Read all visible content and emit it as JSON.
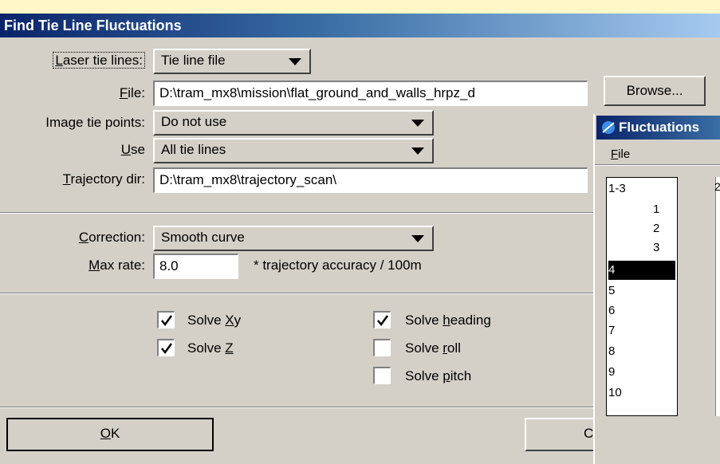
{
  "dialog": {
    "title": "Find Tie Line Fluctuations",
    "laser_tie_lines": {
      "label": "Laser tie lines:",
      "value": "Tie line file"
    },
    "file": {
      "label": "File:",
      "value": "D:\\tram_mx8\\mission\\flat_ground_and_walls_hrpz_d"
    },
    "browse_label": "Browse...",
    "image_tie_points": {
      "label": "Image tie points:",
      "value": "Do not use"
    },
    "use": {
      "label": "Use",
      "value": "All tie lines"
    },
    "trajectory_dir": {
      "label": "Trajectory dir:",
      "value": "D:\\tram_mx8\\trajectory_scan\\"
    },
    "correction": {
      "label": "Correction:",
      "value": "Smooth curve"
    },
    "max_rate": {
      "label": "Max rate:",
      "value": "8.0",
      "note": "* trajectory accuracy / 100m"
    },
    "checkboxes": [
      {
        "label": "Solve Xy",
        "checked": true
      },
      {
        "label": "Solve Z",
        "checked": true
      },
      {
        "label": "Solve heading",
        "checked": true
      },
      {
        "label": "Solve roll",
        "checked": false
      },
      {
        "label": "Solve pitch",
        "checked": false
      }
    ],
    "ok_label": "OK",
    "cancel_partial": "C"
  },
  "fluctuations": {
    "title": "Fluctuations",
    "menu_file": "File",
    "items": [
      "1-3",
      "1",
      "2",
      "3",
      "4",
      "5",
      "6",
      "7",
      "8",
      "9",
      "10"
    ],
    "selected": "4",
    "partial_text": "2"
  }
}
